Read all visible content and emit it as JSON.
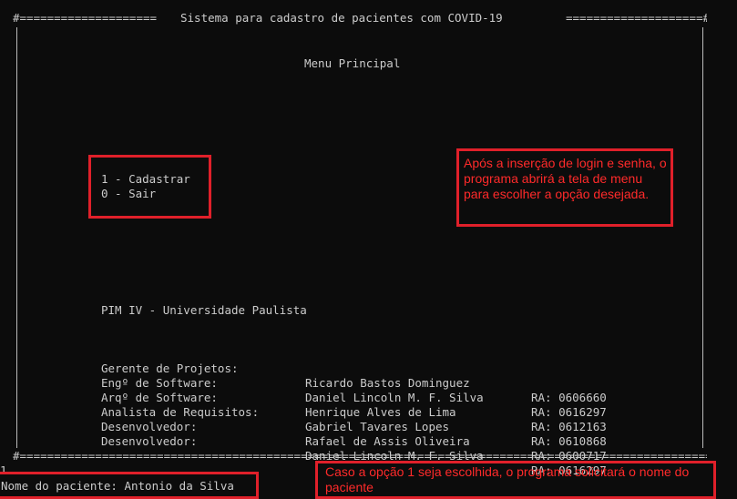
{
  "terminal": {
    "frame_top_left": "#====================",
    "frame_top_right": "====================#",
    "frame_bottom": "#=============================================================================================================#",
    "title": "Sistema para cadastro de pacientes com COVID-19",
    "menu_title": "Menu Principal",
    "options": [
      {
        "label": "1 - Cadastrar"
      },
      {
        "label": "0 - Sair"
      }
    ],
    "institution": "PIM IV - Universidade Paulista",
    "team": [
      {
        "role": "Gerente de Projetos:",
        "name": "Ricardo Bastos Dominguez",
        "ra": "RA: 0606660"
      },
      {
        "role": "Engº de Software:",
        "name": "Daniel Lincoln M. F. Silva",
        "ra": "RA: 0616297"
      },
      {
        "role": "Arqº de Software:",
        "name": "Henrique Alves de Lima",
        "ra": "RA: 0612163"
      },
      {
        "role": "Analista de Requisitos:",
        "name": "Gabriel Tavares Lopes",
        "ra": "RA: 0610868"
      },
      {
        "role": "Desenvolvedor:",
        "name": "Rafael de Assis Oliveira",
        "ra": "RA: 0600717"
      },
      {
        "role": "Desenvolvedor:",
        "name": "Daniel Lincoln M. F. Silva",
        "ra": "RA: 0616297"
      }
    ],
    "input_echo": "1",
    "prompt": "Nome do paciente: Antonio da Silva"
  },
  "annotations": {
    "menu_note": "Após a inserção de login e senha, o programa abrirá a tela de menu para escolher a opção desejada.",
    "name_note": "Caso a opção 1 seja escolhida, o programa solicitará o nome do paciente"
  },
  "colors": {
    "background": "#0c0c0c",
    "text": "#cccccc",
    "annotation": "#e0202a"
  }
}
